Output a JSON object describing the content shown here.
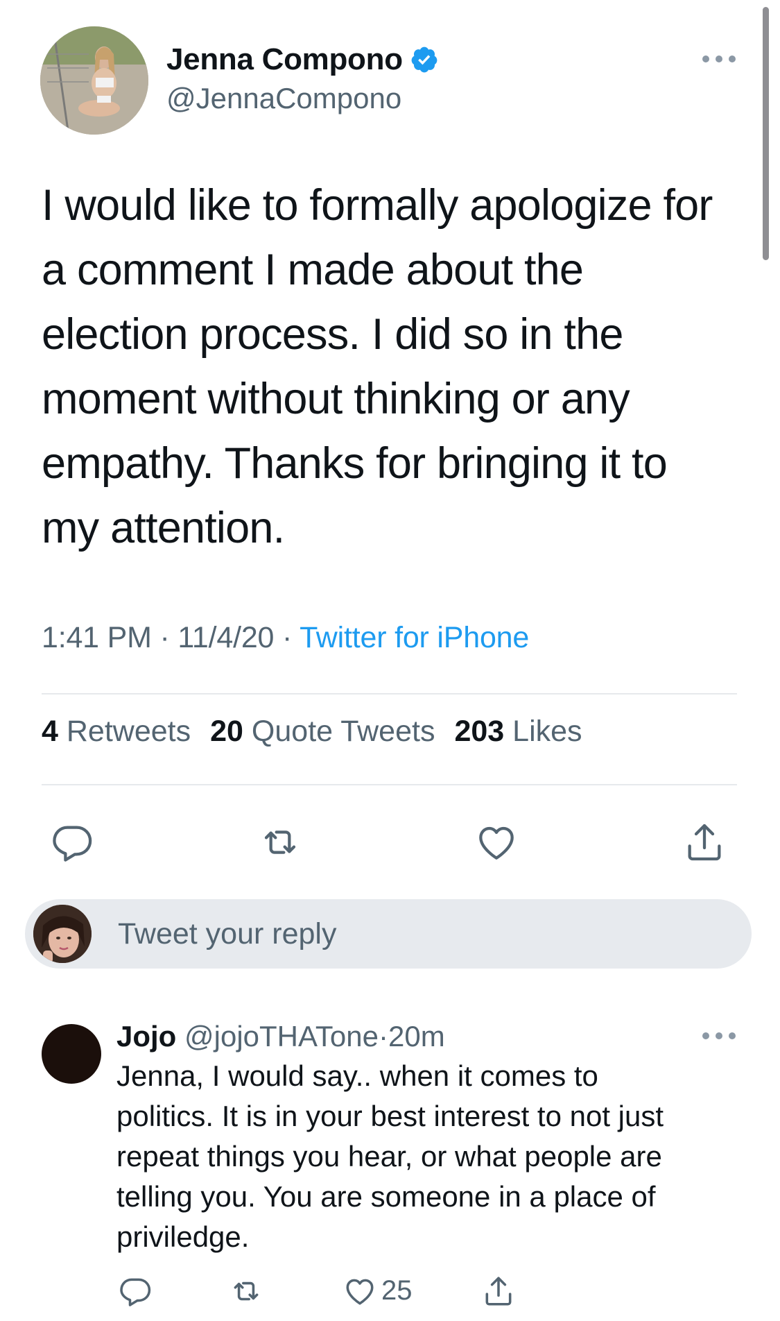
{
  "tweet": {
    "author": {
      "name": "Jenna Compono",
      "handle": "@JennaCompono",
      "verified": true
    },
    "text": "I would like to formally apologize for\na comment I made about the\nelection process. I did so in the\nmoment without thinking or any\nempathy. Thanks for bringing it to\nmy attention.",
    "time": "1:41 PM",
    "date": "11/4/20",
    "separator": "·",
    "source": "Twitter for iPhone",
    "stats": {
      "retweets_count": "4",
      "retweets_label": "Retweets",
      "quotes_count": "20",
      "quotes_label": "Quote Tweets",
      "likes_count": "203",
      "likes_label": "Likes"
    },
    "actions": [
      "reply-icon",
      "retweet-icon",
      "like-icon",
      "share-icon"
    ]
  },
  "composer": {
    "placeholder": "Tweet your reply"
  },
  "reply": {
    "name": "Jojo",
    "handle": "@jojoTHATone",
    "separator": "·",
    "age": "20m",
    "text": "Jenna, I would say..   when it comes to\npolitics. It is in your best interest to not just\nrepeat things you hear, or what people are\ntelling you. You are someone in a place of\npriviledge.",
    "like_count": "25"
  },
  "colors": {
    "accent": "#1d9bf0",
    "text_primary": "#0f1419",
    "text_secondary": "#536471",
    "divider": "#e6e9ec",
    "composer_bg": "#e7eaee"
  }
}
